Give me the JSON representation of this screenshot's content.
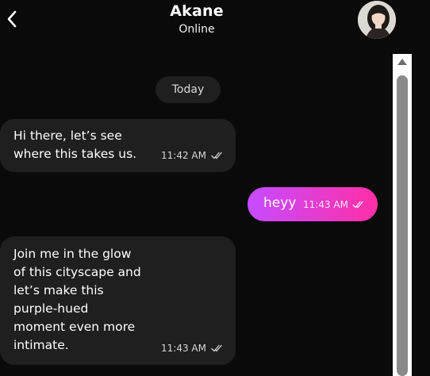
{
  "header": {
    "contact_name": "Akane",
    "status": "Online"
  },
  "date_divider": "Today",
  "messages": [
    {
      "direction": "incoming",
      "text": "Hi there, let’s see\nwhere this takes us.",
      "time": "11:42 AM"
    },
    {
      "direction": "outgoing",
      "text": "heyy",
      "time": "11:43 AM"
    },
    {
      "direction": "incoming",
      "text": "Join me in the glow\nof this cityscape and\nlet’s make this\npurple-hued\nmoment even more\nintimate.",
      "time": "11:43 AM"
    }
  ],
  "icons": {
    "back": "chevron-left-icon",
    "read_receipt": "double-check-icon",
    "scroll_up": "triangle-up-icon"
  },
  "colors": {
    "background": "#0a0a0a",
    "incoming_bubble": "#1f1f1f",
    "outgoing_gradient_start": "#c64bff",
    "outgoing_gradient_end": "#ff2fa6"
  }
}
